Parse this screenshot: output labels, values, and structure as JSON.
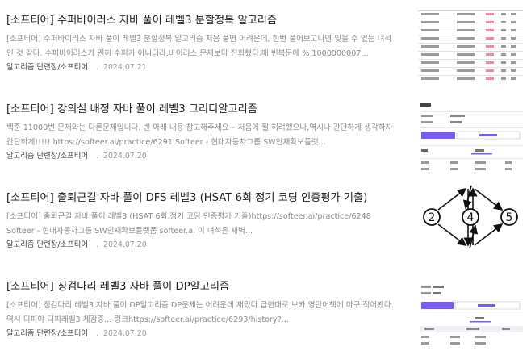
{
  "posts": [
    {
      "title": "[소프티어] 수퍼바이러스 자바 풀이 레벨3 분할정복 알고리즘",
      "excerpt": "[소프티어] 수퍼바이러스 자바 풀이 레벨3 분할정복 알고리즘     처음 풀면 어려운데, 한번 풀어보고나면 잊을 수 없는 녀석인 것 같다.          수퍼바이러스가 괜히 수퍼가 아니더라.바이러스 문제보다 진화했다.매 빈복문에 % 1000000007...",
      "category": "알고리즘 단련장/소프티어",
      "date": "2024.07.21",
      "thumbnail": "table-screenshot"
    },
    {
      "title": "[소프티어] 강의실 배정 자바 풀이 레벨3 그리디알고리즘",
      "excerpt": "백준 11000번 문제와는 다른문제입니다. 밴 아래 내용 참고해주세요~          처음에 뭘 허려했으나,역시나 간단하게 생각하자 간단하게!!!!!  https://softeer.ai/practice/6291 Softeer - 현대자동차그룹 SW인재확보플랫...",
      "category": "알고리즘 단련장/소프티어",
      "date": "2024.07.20",
      "thumbnail": "softeer-page-screenshot"
    },
    {
      "title": "[소프티어] 출퇴근길 자바 풀이 DFS 레벨3 (HSAT 6회 정기 코딩 인증평가 기출)",
      "excerpt": "[소프티어] 출퇴근길 자바 풀이 레벨3 (HSAT 6회 정기 코딩 인증평가 기출)https://softeer.ai/practice/6248 Softeer - 현대자동차그룹 SW인재확보플랫폼 softeer.ai     이 녀석은 새벽...",
      "category": "알고리즘 단련장/소프티어",
      "date": "2024.07.20",
      "thumbnail": "graph-diagram",
      "graph_labels": [
        "2",
        "4",
        "5"
      ]
    },
    {
      "title": "[소프티어] 징검다리 레벨3 자바 풀이 DP알고리즘",
      "excerpt": "[소프티어] 징검다리 레벨3 자바 풀이 DP알고리즘  DP문제는 어려운데 재밌다.급한대로 보카 영단어책에 마구 적어봤다. 역시 디피야 디피레벨3 체감중...     링크https://softeer.ai/practice/6293/history?...",
      "category": "알고리즘 단련장/소프티어",
      "date": "2024.07.20",
      "thumbnail": "softeer-history-screenshot"
    }
  ],
  "colors": {
    "accent": "#7b5cf0",
    "title": "#1a1a1a",
    "excerpt": "#8a8a8a",
    "date": "#999999"
  }
}
